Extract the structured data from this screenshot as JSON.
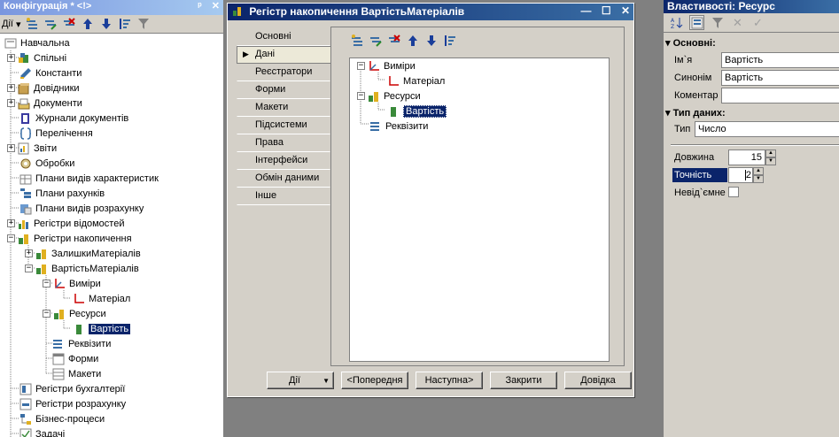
{
  "left_panel": {
    "title": "Конфігурація * <!>",
    "title_pin": "ᵖ",
    "title_close": "✕",
    "actions_label": "Дії",
    "tree": [
      {
        "label": "Навчальна"
      },
      {
        "label": "Спільні"
      },
      {
        "label": "Константи"
      },
      {
        "label": "Довідники"
      },
      {
        "label": "Документи"
      },
      {
        "label": "Журнали документів"
      },
      {
        "label": "Перелічення"
      },
      {
        "label": "Звіти"
      },
      {
        "label": "Обробки"
      },
      {
        "label": "Плани видів характеристик"
      },
      {
        "label": "Плани рахунків"
      },
      {
        "label": "Плани видів розрахунку"
      },
      {
        "label": "Регістри відомостей"
      },
      {
        "label": "Регістри накопичення"
      },
      {
        "label": "ЗалишкиМатеріалів"
      },
      {
        "label": "ВартістьМатеріалів"
      },
      {
        "label": "Виміри"
      },
      {
        "label": "Матеріал"
      },
      {
        "label": "Ресурси"
      },
      {
        "label": "Вартість"
      },
      {
        "label": "Реквізити"
      },
      {
        "label": "Форми"
      },
      {
        "label": "Макети"
      },
      {
        "label": "Регістри бухгалтерії"
      },
      {
        "label": "Регістри розрахунку"
      },
      {
        "label": "Бізнес-процеси"
      },
      {
        "label": "Задачі"
      }
    ]
  },
  "dialog": {
    "title": "Регістр накопичення ВартістьМатеріалів",
    "min": "—",
    "max": "☐",
    "close": "✕",
    "tabs": [
      {
        "label": "Основні"
      },
      {
        "label": "Дані"
      },
      {
        "label": "Реєстратори"
      },
      {
        "label": "Форми"
      },
      {
        "label": "Макети"
      },
      {
        "label": "Підсистеми"
      },
      {
        "label": "Права"
      },
      {
        "label": "Інтерфейси"
      },
      {
        "label": "Обмін даними"
      },
      {
        "label": "Інше"
      }
    ],
    "tree": [
      {
        "label": "Виміри"
      },
      {
        "label": "Матеріал"
      },
      {
        "label": "Ресурси"
      },
      {
        "label": "Вартість"
      },
      {
        "label": "Реквізити"
      }
    ],
    "buttons": {
      "actions": "Дії",
      "prev": "<Попередня",
      "next": "Наступна>",
      "close": "Закрити",
      "help": "Довідка"
    }
  },
  "properties": {
    "title": "Властивості: Ресурс",
    "group_basic": "Основні:",
    "name_label": "Ім`я",
    "name_value": "Вартість",
    "synonym_label": "Синонім",
    "synonym_value": "Вартість",
    "comment_label": "Коментар",
    "comment_value": "",
    "group_type": "Тип даних:",
    "type_label": "Тип",
    "type_value": "Число",
    "length_label": "Довжина",
    "length_value": "15",
    "precision_label": "Точність",
    "precision_value": "2",
    "nonneg_label": "Невід`ємне"
  },
  "colors": {
    "selection": "#0a246a",
    "face": "#d4d0c8"
  }
}
